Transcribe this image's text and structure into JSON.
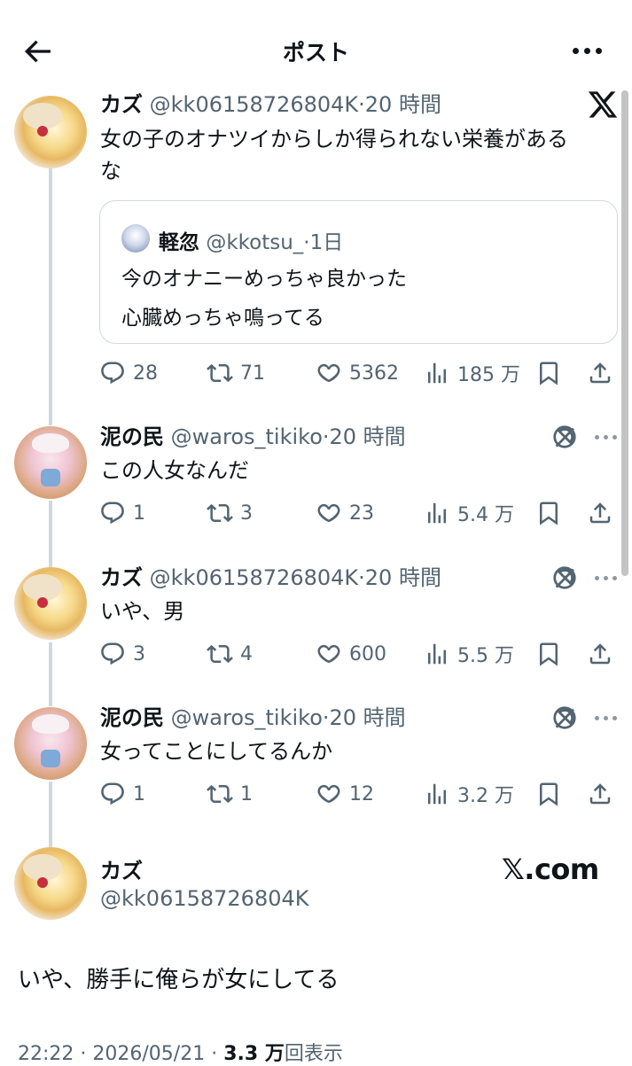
{
  "topbar": {
    "title": "ポスト"
  },
  "posts": [
    {
      "name": "カズ",
      "handle": "@kk06158726804K",
      "time": "20 時間",
      "text_lines": [
        "女の子のオナツイからしか得られない栄養がある",
        "な"
      ],
      "quote": {
        "name": "軽忽",
        "handle": "@kkotsu_",
        "time": "1日",
        "text_lines": [
          "今のオナニーめっちゃ良かった",
          "心臓めっちゃ鳴ってる"
        ]
      },
      "replies": "28",
      "reposts": "71",
      "likes": "5362",
      "views": "185 万"
    },
    {
      "name": "泥の民",
      "handle": "@waros_tikiko",
      "time": "20 時間",
      "text": "この人女なんだ",
      "replies": "1",
      "reposts": "3",
      "likes": "23",
      "views": "5.4 万"
    },
    {
      "name": "カズ",
      "handle": "@kk06158726804K",
      "time": "20 時間",
      "text": "いや、男",
      "replies": "3",
      "reposts": "4",
      "likes": "600",
      "views": "5.5 万"
    },
    {
      "name": "泥の民",
      "handle": "@waros_tikiko",
      "time": "20 時間",
      "text": "女ってことにしてるんか",
      "replies": "1",
      "reposts": "1",
      "likes": "12",
      "views": "3.2 万"
    }
  ],
  "main": {
    "name": "カズ",
    "handle": "@kk06158726804K",
    "brand": "𝕏.com",
    "text": "いや、勝手に俺らが女にしてる",
    "time": "22:22",
    "date": "2026/05/21",
    "views_count": "3.3 万",
    "views_label": "回表示"
  },
  "colors": {
    "text": "#0f1419",
    "secondary": "#536471",
    "border": "#cfd9de",
    "background": "#ffffff"
  },
  "icons": [
    "back-arrow-icon",
    "more-icon",
    "x-logo-icon",
    "grok-icon",
    "reply-icon",
    "repost-icon",
    "like-icon",
    "views-icon",
    "bookmark-icon",
    "share-icon"
  ]
}
